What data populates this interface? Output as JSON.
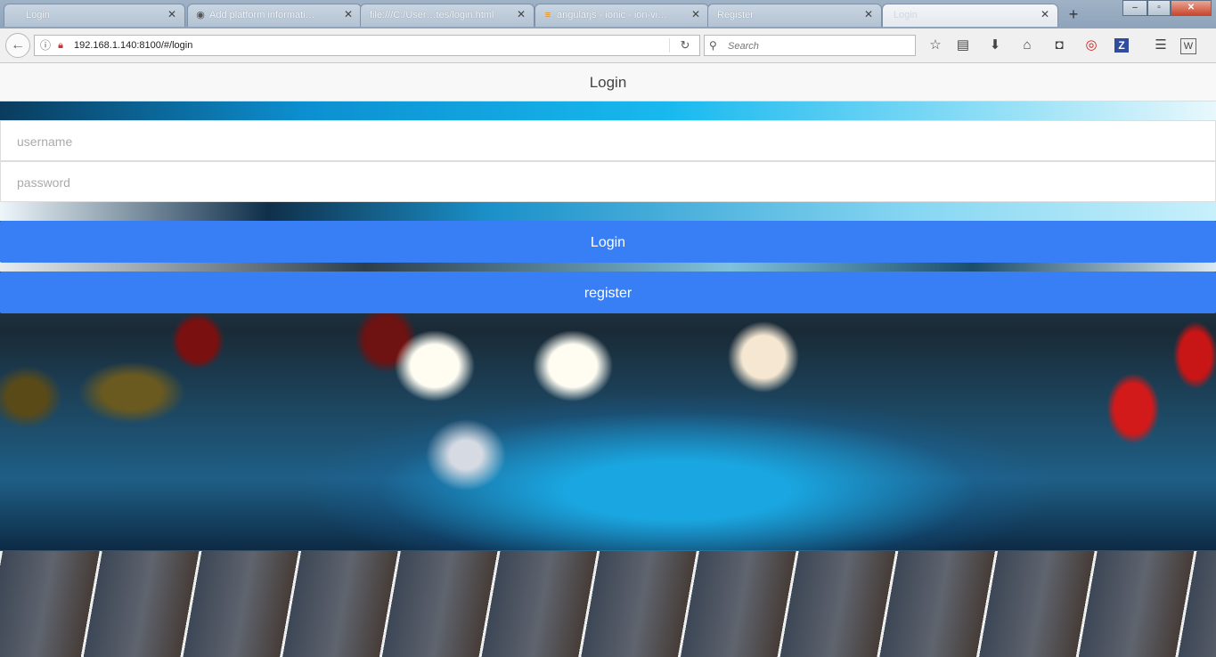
{
  "browser": {
    "tabs": [
      {
        "label": "Login",
        "icon": "ionic-icon",
        "active": false
      },
      {
        "label": "Add platform informati…",
        "icon": "github-icon",
        "active": false
      },
      {
        "label": "file:///C:/User…tes/login.html",
        "icon": "file-icon",
        "active": false
      },
      {
        "label": "angularjs - ionic - ion-vi…",
        "icon": "stackoverflow-icon",
        "active": false
      },
      {
        "label": "Register",
        "icon": "ionic-icon",
        "active": false
      },
      {
        "label": "Login",
        "icon": "ionic-icon",
        "active": true
      }
    ],
    "new_tab": "+",
    "url": "192.168.1.140:8100/#/login",
    "search_placeholder": "Search",
    "window_controls": {
      "minimize": "‒",
      "maximize": "▫",
      "close": "✕"
    }
  },
  "app": {
    "header_title": "Login",
    "username_placeholder": "username",
    "password_placeholder": "password",
    "login_button": "Login",
    "register_button": "register",
    "accent_color": "#387ef5"
  }
}
